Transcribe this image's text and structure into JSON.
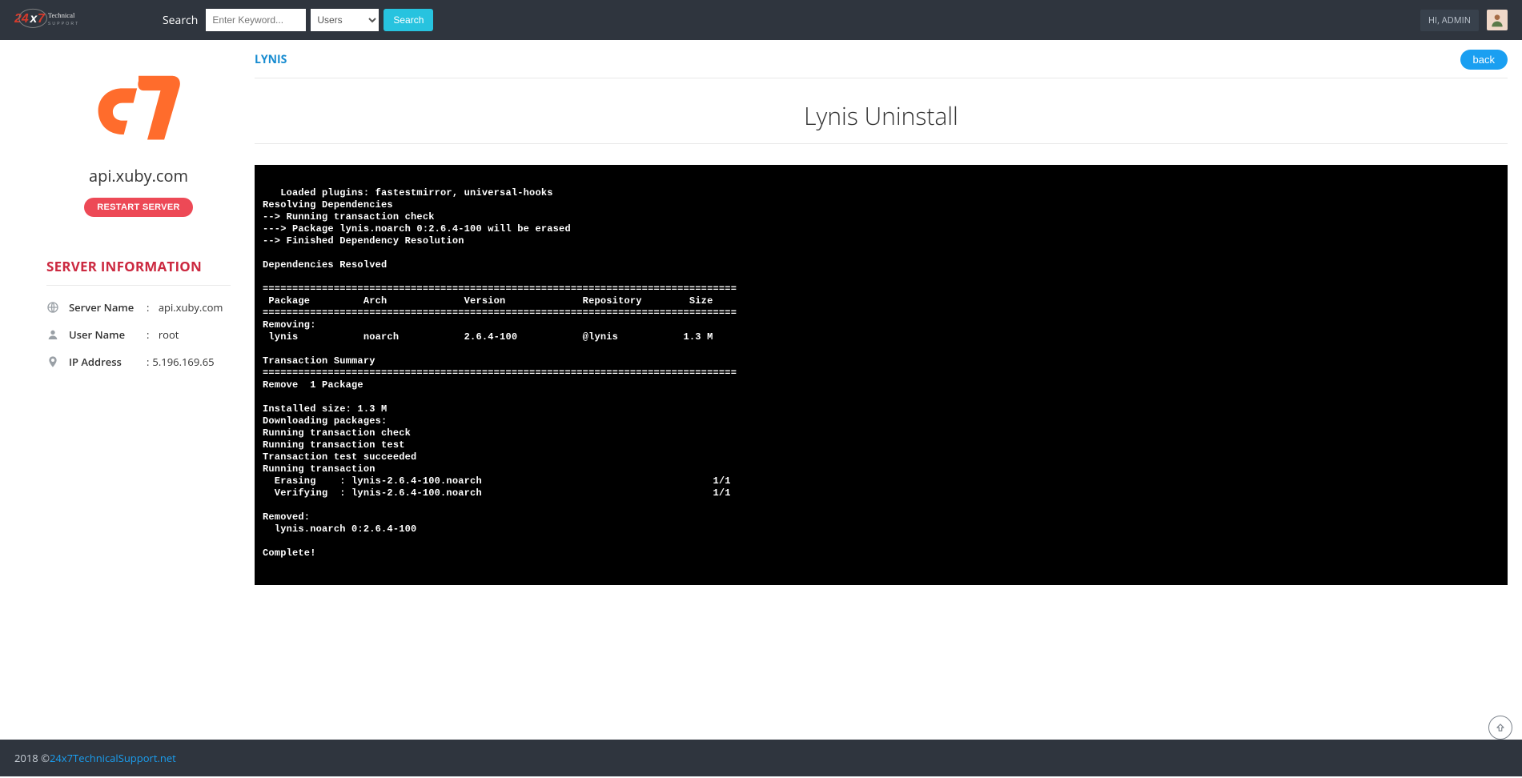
{
  "topbar": {
    "search_label": "Search",
    "search_placeholder": "Enter Keyword...",
    "dropdown_selected": "Users",
    "search_button": "Search",
    "greeting": "HI, ADMIN"
  },
  "sidebar": {
    "domain": "api.xuby.com",
    "restart_button": "RESTART SERVER",
    "section_title": "SERVER INFORMATION",
    "rows": [
      {
        "icon": "globe",
        "label": "Server Name",
        "value": "api.xuby.com"
      },
      {
        "icon": "user",
        "label": "User Name",
        "value": "root"
      },
      {
        "icon": "map",
        "label": "IP Address",
        "value": "5.196.169.65"
      }
    ]
  },
  "content": {
    "breadcrumb": "LYNIS",
    "back_button": "back",
    "page_title": "Lynis Uninstall",
    "terminal": "   Loaded plugins: fastestmirror, universal-hooks\nResolving Dependencies\n--> Running transaction check\n---> Package lynis.noarch 0:2.6.4-100 will be erased\n--> Finished Dependency Resolution\n\nDependencies Resolved\n\n================================================================================\n Package         Arch             Version             Repository        Size\n================================================================================\nRemoving:\n lynis           noarch           2.6.4-100           @lynis           1.3 M\n\nTransaction Summary\n================================================================================\nRemove  1 Package\n\nInstalled size: 1.3 M\nDownloading packages:\nRunning transaction check\nRunning transaction test\nTransaction test succeeded\nRunning transaction\n  Erasing    : lynis-2.6.4-100.noarch                                       1/1 \n  Verifying  : lynis-2.6.4-100.noarch                                       1/1 \n\nRemoved:\n  lynis.noarch 0:2.6.4-100                                                      \n\nComplete!"
  },
  "footer": {
    "year": "2018 © ",
    "link_text": "24x7TechnicalSupport.net"
  },
  "colors": {
    "accent_red": "#cc2a41",
    "accent_blue": "#1a9ff1",
    "accent_cyan": "#27c3df",
    "cpanel_orange": "#ff6c2c"
  }
}
